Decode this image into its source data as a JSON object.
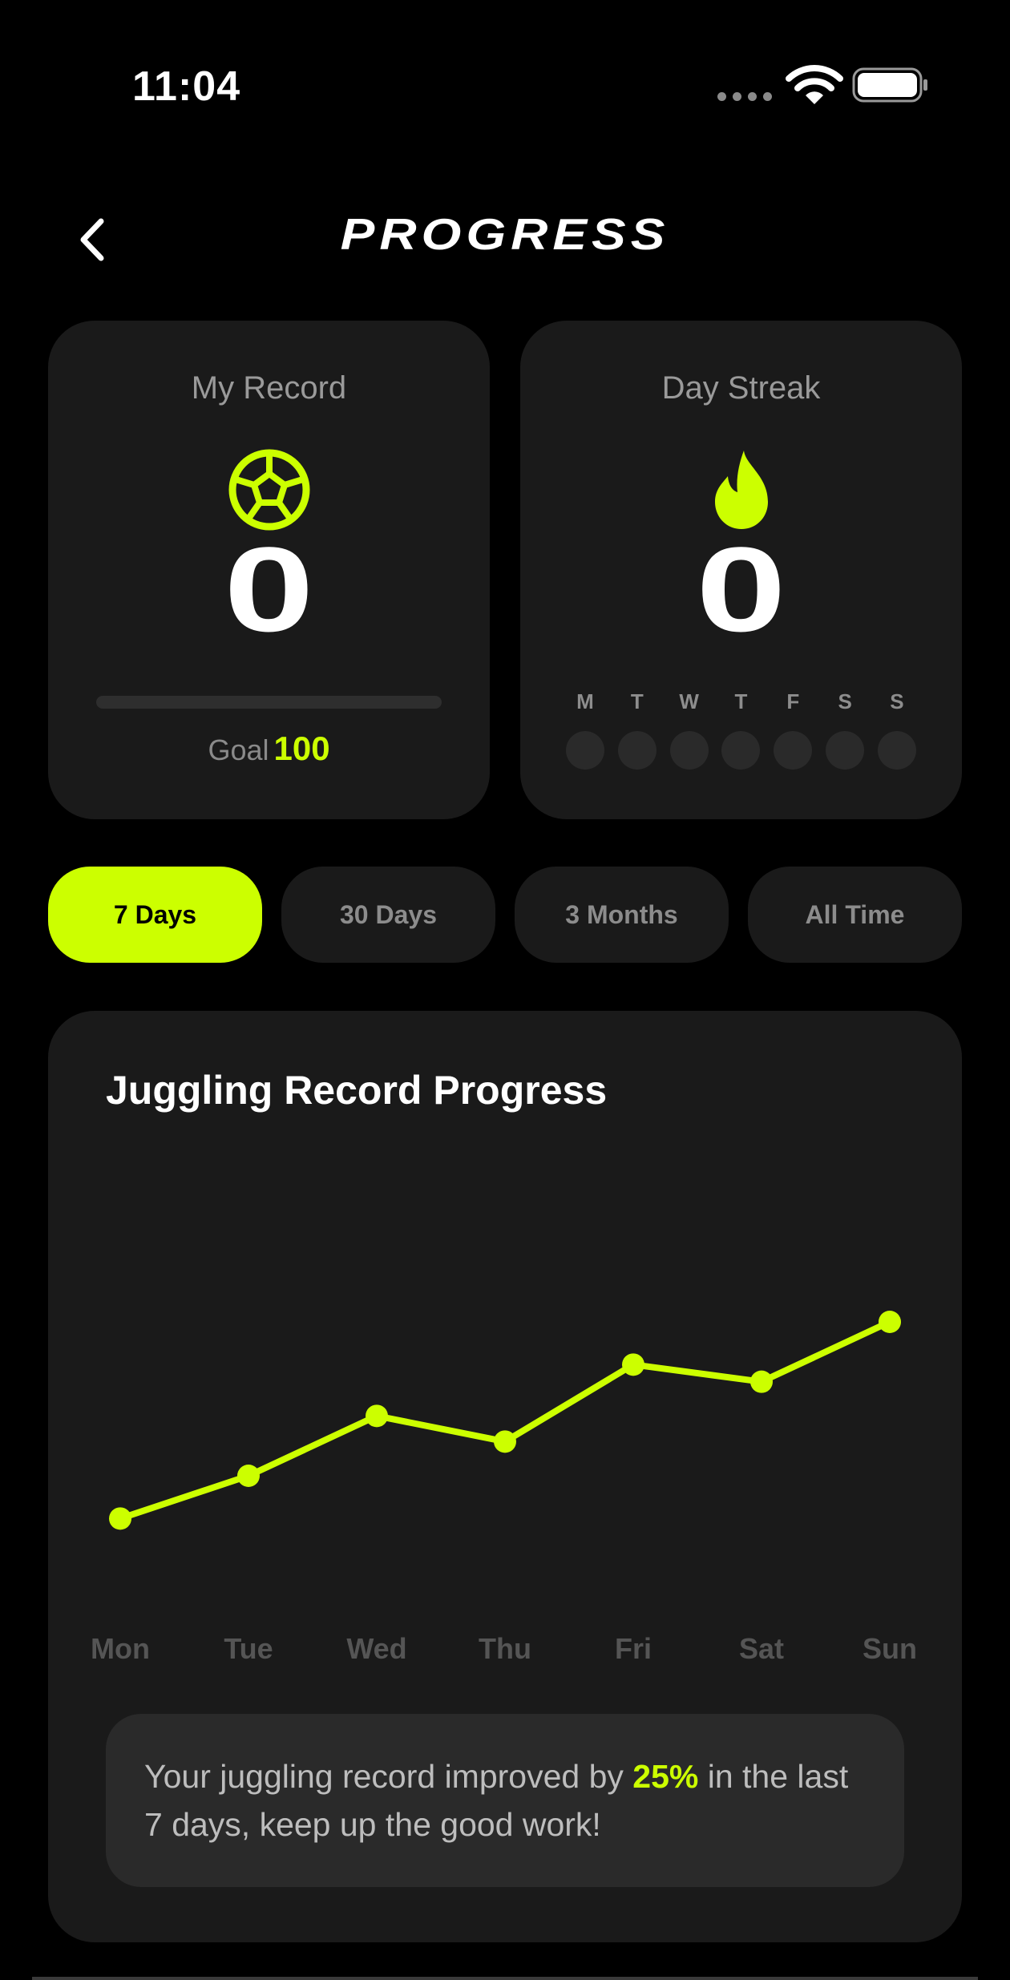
{
  "status_bar": {
    "time": "11:04"
  },
  "header": {
    "title": "PROGRESS",
    "back_icon": "chevron-left-icon"
  },
  "record_card": {
    "label": "My Record",
    "icon": "soccer-ball-icon",
    "value": "0",
    "goal_label": "Goal",
    "goal_value": "100",
    "progress_fraction": 0
  },
  "streak_card": {
    "label": "Day Streak",
    "icon": "flame-icon",
    "value": "0",
    "days": [
      "M",
      "T",
      "W",
      "T",
      "F",
      "S",
      "S"
    ],
    "completed": [
      false,
      false,
      false,
      false,
      false,
      false,
      false
    ]
  },
  "tabs": [
    {
      "label": "7 Days",
      "active": true
    },
    {
      "label": "30 Days",
      "active": false
    },
    {
      "label": "3 Months",
      "active": false
    },
    {
      "label": "All Time",
      "active": false
    }
  ],
  "chart": {
    "title": "Juggling Record Progress"
  },
  "chart_data": {
    "type": "line",
    "categories": [
      "Mon",
      "Tue",
      "Wed",
      "Thu",
      "Fri",
      "Sat",
      "Sun"
    ],
    "series": [
      {
        "values": [
          10,
          15,
          22,
          19,
          28,
          26,
          33
        ]
      }
    ],
    "ylim": [
      0,
      45
    ],
    "grid": false,
    "color": "#ccff00"
  },
  "summary": {
    "prefix": "Your juggling record improved by ",
    "highlight": "25%",
    "suffix": " in the last 7 days, keep up the good work!"
  },
  "colors": {
    "accent": "#ccff00",
    "background": "#000000",
    "card": "#1a1a1a"
  }
}
